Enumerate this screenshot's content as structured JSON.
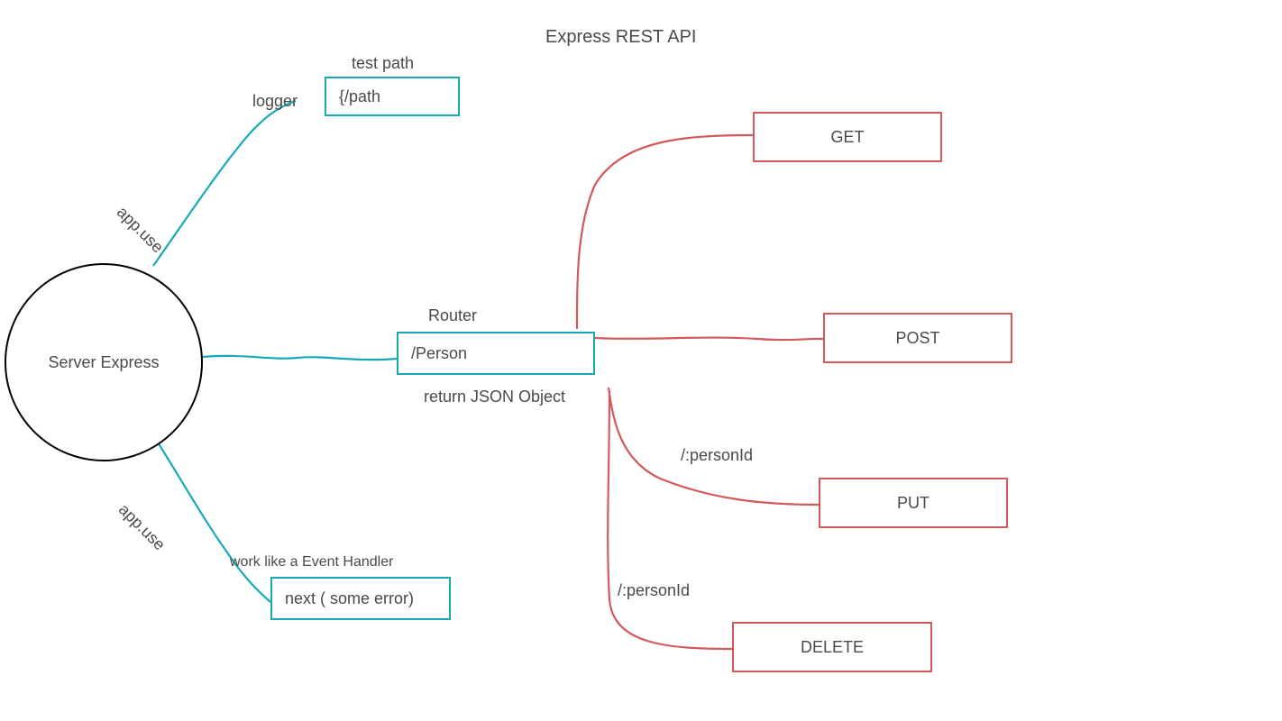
{
  "title": "Express REST API",
  "server": {
    "label": "Server Express"
  },
  "edges": {
    "app_use_top": "app.use",
    "app_use_bottom": "app.use"
  },
  "logger": {
    "label": "logger",
    "test_path_label": "test path",
    "test_path_box": "{/path"
  },
  "error_handler": {
    "caption": "work like a Event Handler",
    "box": "next ( some error)"
  },
  "router": {
    "label": "Router",
    "box": "/Person",
    "return_label": "return JSON Object"
  },
  "methods": {
    "get": {
      "label": "GET"
    },
    "post": {
      "label": "POST"
    },
    "put": {
      "label": "PUT",
      "path": "/:personId"
    },
    "delete": {
      "label": "DELETE",
      "path": "/:personId"
    }
  }
}
